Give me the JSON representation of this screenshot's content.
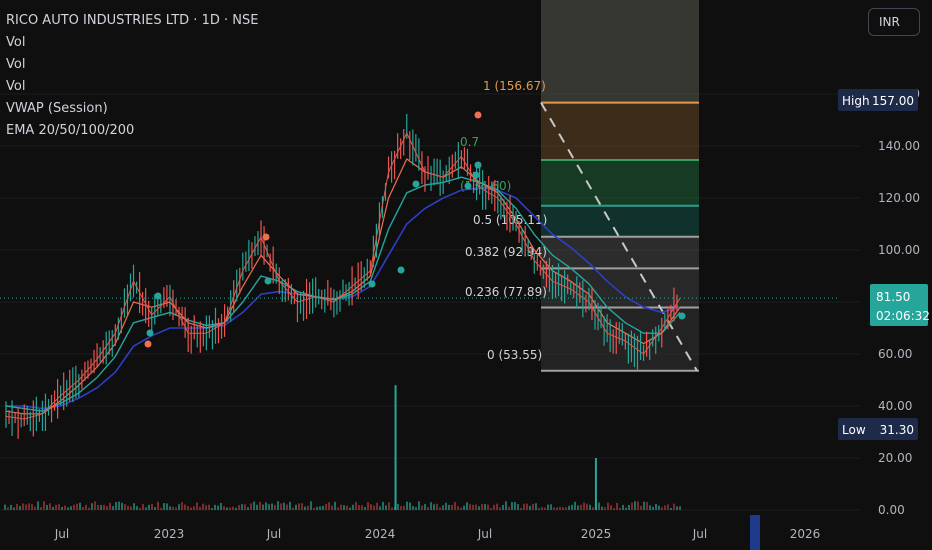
{
  "legend": {
    "title": "RICO AUTO INDUSTRIES LTD · 1D · NSE",
    "indicators": [
      "Vol",
      "Vol",
      "Vol",
      "VWAP (Session)",
      "EMA 20/50/100/200"
    ]
  },
  "currency": "INR",
  "colors": {
    "background": "#0f0f0f",
    "price_line": "#e05a4a",
    "ema20": "#f07050",
    "ema50": "#26a69a",
    "ema100": "#2d3fc7",
    "fib_levels": [
      "#f5a623",
      "#1b5e20",
      "#004d40",
      "#4a4a4a"
    ],
    "up": "#26a69a",
    "down": "#ef5350"
  },
  "chart_data": {
    "type": "line",
    "title": "RICO AUTO INDUSTRIES LTD · 1D · NSE",
    "xlabel": "",
    "ylabel": "",
    "ylim": [
      0,
      170
    ],
    "x_ticks": [
      "Jul",
      "2023",
      "Jul",
      "2024",
      "Jul",
      "2025",
      "Jul",
      "2026"
    ],
    "y_ticks": [
      0,
      20,
      40,
      60,
      80,
      100,
      120,
      140,
      160
    ],
    "y_tick_labels": [
      "0.00",
      "20.00",
      "40.00",
      "60.00",
      "80.00",
      "100.00",
      "120.00",
      "140.00",
      "160.00"
    ],
    "price": {
      "dates": [
        "2022-05",
        "2022-06",
        "2022-07",
        "2022-08",
        "2022-09",
        "2022-10",
        "2022-11",
        "2022-12",
        "2023-01",
        "2023-02",
        "2023-03",
        "2023-04",
        "2023-05",
        "2023-06",
        "2023-07",
        "2023-08",
        "2023-09",
        "2023-10",
        "2023-11",
        "2023-12",
        "2024-01",
        "2024-02",
        "2024-03",
        "2024-04",
        "2024-05",
        "2024-06",
        "2024-07",
        "2024-08",
        "2024-09",
        "2024-10",
        "2024-11",
        "2024-12",
        "2025-01",
        "2025-02",
        "2025-03",
        "2025-04",
        "2025-05",
        "2025-06"
      ],
      "values": [
        36,
        35,
        37,
        44,
        50,
        58,
        68,
        88,
        75,
        82,
        68,
        68,
        72,
        92,
        105,
        88,
        80,
        82,
        80,
        86,
        92,
        130,
        145,
        130,
        128,
        136,
        124,
        120,
        110,
        96,
        88,
        85,
        80,
        68,
        65,
        60,
        70,
        81.5
      ]
    },
    "ema20": [
      38,
      37,
      37,
      42,
      48,
      55,
      64,
      80,
      78,
      80,
      72,
      70,
      72,
      86,
      98,
      90,
      83,
      82,
      81,
      84,
      90,
      120,
      135,
      130,
      128,
      132,
      126,
      122,
      112,
      100,
      92,
      88,
      83,
      72,
      68,
      64,
      68,
      78
    ],
    "ema50": [
      40,
      39,
      38,
      41,
      45,
      51,
      59,
      72,
      74,
      76,
      73,
      71,
      72,
      80,
      90,
      88,
      84,
      82,
      81,
      83,
      88,
      108,
      122,
      125,
      126,
      128,
      126,
      123,
      116,
      106,
      98,
      93,
      87,
      78,
      72,
      68,
      68,
      76
    ],
    "ema100": [
      40,
      40,
      39,
      40,
      43,
      47,
      53,
      63,
      67,
      70,
      70,
      70,
      71,
      76,
      83,
      84,
      83,
      82,
      81,
      82,
      86,
      98,
      110,
      116,
      120,
      123,
      124,
      123,
      120,
      113,
      106,
      101,
      95,
      88,
      82,
      78,
      76,
      78
    ],
    "volume": {
      "max": 48,
      "highlights": [
        {
          "date": "2024-02",
          "value": 48
        },
        {
          "date": "2025-01",
          "value": 20
        }
      ]
    },
    "fibonacci": [
      {
        "ratio": "1",
        "price": 156.67,
        "label": "1 (156.67)"
      },
      {
        "ratio": "0.786",
        "price": 134.6,
        "label": "0.786 (134.60)"
      },
      {
        "ratio": "0.618",
        "price": 117.0,
        "label": ""
      },
      {
        "ratio": "0.5",
        "price": 105.11,
        "label": "0.5 (105.11)"
      },
      {
        "ratio": "0.382",
        "price": 92.94,
        "label": "0.382 (92.94)"
      },
      {
        "ratio": "0.236",
        "price": 77.89,
        "label": "0.236 (77.89)"
      },
      {
        "ratio": "0",
        "price": 53.55,
        "label": "0 (53.55)"
      }
    ],
    "fib_visible_labels": [
      "1 (156.67)",
      "0.7",
      "(134.60)",
      "0.5 (105.11)",
      "0.382 (92.94)",
      "0.236 (77.89)",
      "0 (53.55)"
    ],
    "badges": {
      "high": {
        "label": "High",
        "value": "157.00"
      },
      "low": {
        "label": "Low",
        "value": "31.30"
      },
      "last": {
        "value": "81.50",
        "countdown": "02:06:32"
      }
    }
  }
}
